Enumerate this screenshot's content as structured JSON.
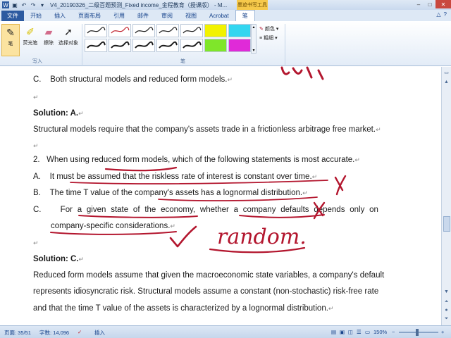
{
  "title_bar": {
    "title": "V4_20190326_二级百题预测_Fixed income_金程教育（授课版） - M...",
    "ink_tools_label": "墨迹书写工具"
  },
  "tabs": [
    "文件",
    "开始",
    "插入",
    "页面布局",
    "引用",
    "邮件",
    "审阅",
    "视图",
    "Acrobat",
    "笔"
  ],
  "ribbon": {
    "tools": [
      {
        "label": "笔",
        "icon": "pen-icon"
      },
      {
        "label": "荧光笔",
        "icon": "highlighter-icon"
      },
      {
        "label": "擦除",
        "icon": "eraser-icon"
      },
      {
        "label": "选择对象",
        "icon": "cursor-icon"
      }
    ],
    "group_write": "写入",
    "group_pen": "笔",
    "color_label": "颜色",
    "weight_label": "粗细",
    "pen_colors": [
      "#1a1a1a",
      "#c0202b",
      "#1a1a1a",
      "#1a1a1a",
      "#1a1a1a",
      "#f2f200",
      "#33d6f0",
      "#1a1a1a",
      "#1a1a1a",
      "#1a1a1a",
      "#1a1a1a",
      "#1a1a1a",
      "#7fe62a",
      "#e02ad8"
    ]
  },
  "document": {
    "line_c1": "C.    Both structural models and reduced form models.",
    "solution_a_label": "Solution: ",
    "solution_a_value": "A.",
    "structural_text": "Structural models require that the company's assets trade in a frictionless arbitrage free market.",
    "q2": "2.   When using reduced form models, which of the following statements is most accurate.",
    "opt_a": "A.    It must be assumed that the riskless rate of interest is constant over time.",
    "opt_b": "B.    The time T value of the company's assets has a lognormal distribution.",
    "opt_c_line1": "C.    For a given state of the economy, whether a company defaults depends only on",
    "opt_c_line2": "company-specific considerations.",
    "solution_c_label": "Solution: ",
    "solution_c_value": "C.",
    "expl_1": "Reduced form models assume that given the macroeconomic state variables, a company's default",
    "expl_2": "represents idiosyncratic risk. Structural models assume a constant (non-stochastic) risk-free rate",
    "expl_3": "and that the time T value of the assets is characterized by a lognormal distribution.",
    "paragraph_mark": "↵"
  },
  "status_bar": {
    "page": "页面: 35/51",
    "words": "字数: 14,096",
    "mode": "插入",
    "zoom": "150%"
  },
  "ink": {
    "word_random": "random."
  }
}
